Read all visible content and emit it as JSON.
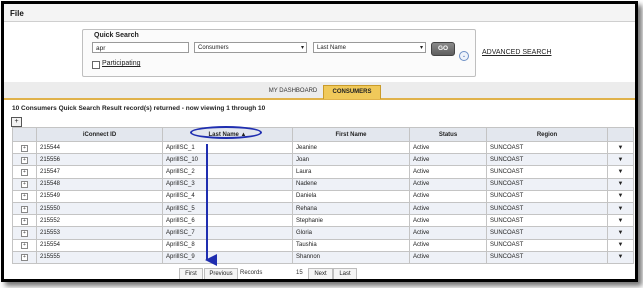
{
  "menu": {
    "file": "File"
  },
  "quick_search": {
    "title": "Quick Search",
    "search_value": "apr",
    "type_select": "Consumers",
    "field_select": "Last Name",
    "go_label": "GO",
    "participating_label": "Participating",
    "advanced_label": "ADVANCED SEARCH"
  },
  "tabs": [
    {
      "label": "MY DASHBOARD",
      "active": false
    },
    {
      "label": "CONSUMERS",
      "active": true
    }
  ],
  "result_text": "10 Consumers Quick Search Result record(s) returned - now viewing 1 through 10",
  "add_label": "+",
  "table": {
    "headers": [
      "iConnect ID",
      "Last Name ▲",
      "First Name",
      "Status",
      "Region"
    ],
    "rows": [
      [
        "215544",
        "AprilISC_1",
        "Jeanine",
        "Active",
        "SUNCOAST"
      ],
      [
        "215556",
        "AprilISC_10",
        "Joan",
        "Active",
        "SUNCOAST"
      ],
      [
        "215547",
        "AprilISC_2",
        "Laura",
        "Active",
        "SUNCOAST"
      ],
      [
        "215548",
        "AprilISC_3",
        "Nadene",
        "Active",
        "SUNCOAST"
      ],
      [
        "215549",
        "AprilISC_4",
        "Daniela",
        "Active",
        "SUNCOAST"
      ],
      [
        "215550",
        "AprilISC_5",
        "Rehana",
        "Active",
        "SUNCOAST"
      ],
      [
        "215552",
        "AprilISC_6",
        "Stephanie",
        "Active",
        "SUNCOAST"
      ],
      [
        "215553",
        "AprilISC_7",
        "Gloria",
        "Active",
        "SUNCOAST"
      ],
      [
        "215554",
        "AprilISC_8",
        "Taushia",
        "Active",
        "SUNCOAST"
      ],
      [
        "215555",
        "AprilISC_9",
        "Shannon",
        "Active",
        "SUNCOAST"
      ]
    ]
  },
  "pager": {
    "first": "First",
    "previous": "Previous",
    "per_page_label": "Records per page",
    "per_page_value": "15",
    "next": "Next",
    "last": "Last"
  },
  "colors": {
    "tab_active": "#f0c95a",
    "annotation": "#1f2eb0",
    "header_bg": "#e3e7ee"
  }
}
